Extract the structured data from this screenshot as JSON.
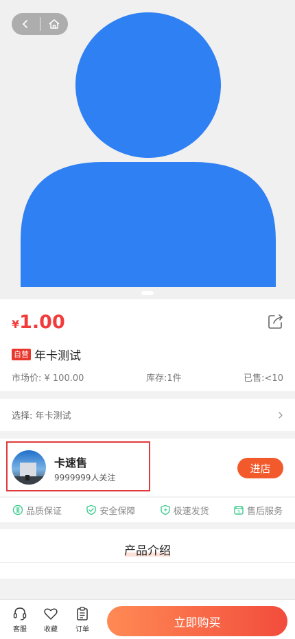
{
  "hero": {
    "back_icon": "chevron-left-icon",
    "home_icon": "home-icon",
    "image_icon": "user-silhouette-placeholder",
    "avatar_color": "#2f80f2"
  },
  "product": {
    "currency": "¥",
    "price": "1.00",
    "self_badge": "自营",
    "title": "年卡测试",
    "market_price": "市场价: ¥ 100.00",
    "stock": "库存:1件",
    "sold": "已售:<10"
  },
  "selection": {
    "text": "选择:  年卡测试"
  },
  "shop": {
    "name": "卡速售",
    "followers": "9999999人关注",
    "enter_label": "进店"
  },
  "services": [
    {
      "label": "品质保证",
      "icon": "quality-icon"
    },
    {
      "label": "安全保障",
      "icon": "shield-check-icon"
    },
    {
      "label": "极速发货",
      "icon": "lightning-shield-icon"
    },
    {
      "label": "售后服务",
      "icon": "after-sale-icon"
    }
  ],
  "intro": {
    "title": "产品介绍"
  },
  "bottom": {
    "tabs": [
      {
        "label": "客服",
        "icon": "headset-icon"
      },
      {
        "label": "收藏",
        "icon": "heart-icon"
      },
      {
        "label": "订单",
        "icon": "clipboard-icon"
      }
    ],
    "buy_label": "立即购买"
  },
  "colors": {
    "accent": "#f23c3c",
    "service_icon": "#3ecb8e",
    "enter_button": "#f25a2c",
    "highlight_border": "#e0393b"
  }
}
